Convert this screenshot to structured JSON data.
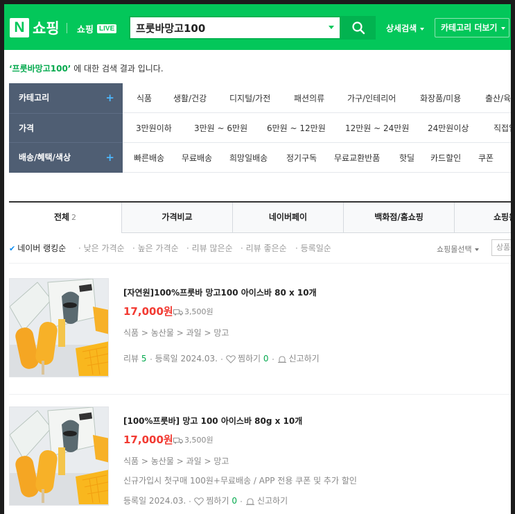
{
  "header": {
    "logo_letter": "N",
    "logo_text": "쇼핑",
    "live_text": "쇼핑",
    "live_badge": "LIVE",
    "search_value": "프룻바망고100",
    "detail_search": "상세검색",
    "category_more": "카테고리 더보기",
    "brand_color": "#03c75a"
  },
  "result": {
    "query": "‘프룻바망고100’",
    "suffix": " 에 대한 검색 결과 입니다."
  },
  "filters": [
    {
      "label": "카테고리",
      "plus": "+",
      "options": [
        "식품",
        "생활/건강",
        "디지털/가전",
        "패션의류",
        "가구/인테리어",
        "화장품/미용",
        "출산/육아"
      ]
    },
    {
      "label": "가격",
      "plus": "",
      "options": [
        "3만원이하",
        "3만원 ~ 6만원",
        "6만원 ~ 12만원",
        "12만원 ~ 24만원",
        "24만원이상",
        "직접입력"
      ]
    },
    {
      "label": "배송/혜택/색상",
      "plus": "+",
      "options": [
        "빠른배송",
        "무료배송",
        "희망일배송",
        "정기구독",
        "무료교환반품",
        "핫딜",
        "카드할인",
        "쿠폰"
      ]
    }
  ],
  "tabs": [
    {
      "label": "전체",
      "count": "2"
    },
    {
      "label": "가격비교"
    },
    {
      "label": "네이버페이"
    },
    {
      "label": "백화점/홈쇼핑"
    },
    {
      "label": "쇼핑윈도"
    }
  ],
  "sort": {
    "items": [
      "네이버 랭킹순",
      "낮은 가격순",
      "높은 가격순",
      "리뷰 많은순",
      "리뷰 좋은순",
      "등록일순"
    ],
    "mall_select": "쇼핑몰선택",
    "mall_search": "상품"
  },
  "products": [
    {
      "title": "[자연원]100%프룻바 망고100 아이스바 80 x 10개",
      "price": "17,000원",
      "shipping": "3,500원",
      "category": "식품 > 농산물 > 과일 > 망고",
      "review_label": "리뷰",
      "review_count": "5",
      "registered": "등록일 2024.03.",
      "like_label": "찜하기",
      "like_count": "0",
      "report": "신고하기"
    },
    {
      "title": "[100%프룻바] 망고 100 아이스바 80g x 10개",
      "price": "17,000원",
      "shipping": "3,500원",
      "category": "식품 > 농산물 > 과일 > 망고",
      "promo": "신규가입시 첫구매 100원+무료배송 / APP 전용 쿠폰 및 추가 할인",
      "registered": "등록일 2024.03.",
      "like_label": "찜하기",
      "like_count": "0",
      "report": "신고하기"
    }
  ]
}
